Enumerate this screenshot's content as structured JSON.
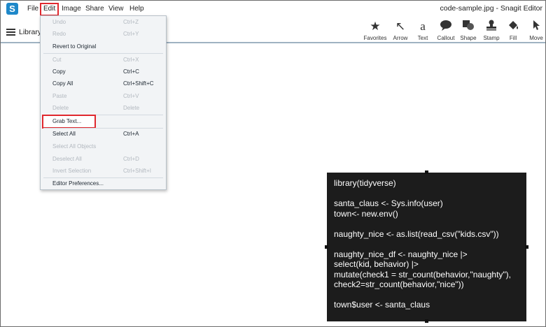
{
  "app": {
    "icon_letter": "S",
    "window_title": "code-sample.jpg - Snagit Editor"
  },
  "menubar": {
    "items": [
      "File",
      "Edit",
      "Image",
      "Share",
      "View",
      "Help"
    ]
  },
  "toolbar": {
    "library_label": "Library",
    "tools": [
      {
        "label": "Favorites",
        "icon": "star-icon"
      },
      {
        "label": "Arrow",
        "icon": "arrow-icon"
      },
      {
        "label": "Text",
        "icon": "text-icon"
      },
      {
        "label": "Callout",
        "icon": "callout-icon"
      },
      {
        "label": "Shape",
        "icon": "shape-icon"
      },
      {
        "label": "Stamp",
        "icon": "stamp-icon"
      },
      {
        "label": "Fill",
        "icon": "fill-icon"
      },
      {
        "label": "Move",
        "icon": "move-icon"
      }
    ]
  },
  "edit_menu": {
    "items": [
      {
        "label": "Undo",
        "shortcut": "Ctrl+Z",
        "enabled": false
      },
      {
        "label": "Redo",
        "shortcut": "Ctrl+Y",
        "enabled": false
      },
      {
        "label": "Revert to Original",
        "shortcut": "",
        "enabled": true
      },
      {
        "label": "Cut",
        "shortcut": "Ctrl+X",
        "enabled": false
      },
      {
        "label": "Copy",
        "shortcut": "Ctrl+C",
        "enabled": true
      },
      {
        "label": "Copy All",
        "shortcut": "Ctrl+Shift+C",
        "enabled": true
      },
      {
        "label": "Paste",
        "shortcut": "Ctrl+V",
        "enabled": false
      },
      {
        "label": "Delete",
        "shortcut": "Delete",
        "enabled": false
      },
      {
        "label": "Grab Text...",
        "shortcut": "",
        "enabled": true,
        "highlighted": true
      },
      {
        "label": "Select All",
        "shortcut": "Ctrl+A",
        "enabled": true
      },
      {
        "label": "Select All Objects",
        "shortcut": "",
        "enabled": false
      },
      {
        "label": "Deselect All",
        "shortcut": "Ctrl+D",
        "enabled": false
      },
      {
        "label": "Invert Selection",
        "shortcut": "Ctrl+Shift+I",
        "enabled": false
      },
      {
        "label": "Editor Preferences...",
        "shortcut": "",
        "enabled": true
      }
    ]
  },
  "code_image": {
    "lines": [
      "library(tidyverse)",
      "",
      "santa_claus <- Sys.info(user)",
      "town<- new.env()",
      "",
      "naughty_nice <- as.list(read_csv(\"kids.csv\"))",
      "",
      "naughty_nice_df <- naughty_nice |>",
      "select(kid, behavior) |>",
      "mutate(check1 = str_count(behavior,\"naughty\"),",
      "check2=str_count(behavior,\"nice\"))",
      "",
      "town$user <- santa_claus"
    ]
  },
  "colors": {
    "accent_red": "#e0282e",
    "snagit_blue": "#1e88c9",
    "code_bg": "#1c1c1c"
  }
}
